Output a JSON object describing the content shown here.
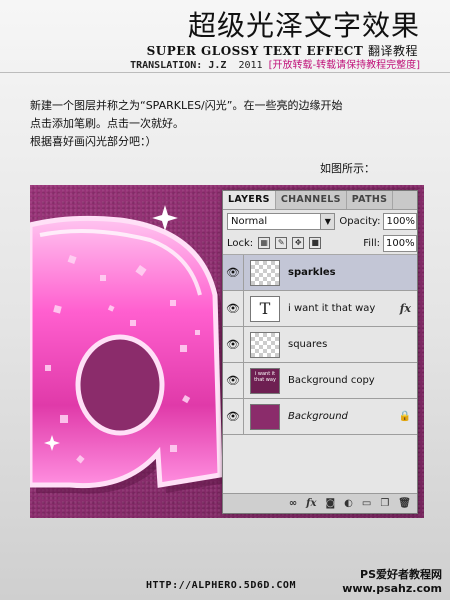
{
  "header": {
    "title_zh": "超级光泽文字效果",
    "title_en": "SUPER GLOSSY TEXT EFFECT",
    "title_en_suffix": "翻译教程",
    "translator": "TRANSLATION: J.Z",
    "year": "2011",
    "notice": "[开放转载-转载请保持教程完整度]"
  },
  "instructions": {
    "line1": "新建一个图层并称之为“SPARKLES/闪光”。在一些亮的边缘开始",
    "line2": "点击添加笔刷。点击一次就好。",
    "line3": "根据喜好画闪光部分吧：）",
    "caption": "如图所示："
  },
  "layers_panel": {
    "tabs": [
      {
        "label": "LAYERS",
        "active": true
      },
      {
        "label": "CHANNELS",
        "active": false
      },
      {
        "label": "PATHS",
        "active": false
      }
    ],
    "blend_mode": "Normal",
    "opacity_label": "Opacity:",
    "opacity_value": "100%",
    "lock_label": "Lock:",
    "fill_label": "Fill:",
    "fill_value": "100%",
    "layers": [
      {
        "name": "sparkles",
        "thumb": "transparent",
        "selected": true
      },
      {
        "name": "i want it that way",
        "thumb": "text",
        "fx": "fx"
      },
      {
        "name": "squares",
        "thumb": "transparent"
      },
      {
        "name": "Background copy",
        "thumb": "image"
      },
      {
        "name": "Background",
        "thumb": "fill",
        "italic": true,
        "locked": true
      }
    ],
    "text_thumb_glyph": "T",
    "bgcopy_thumb_text": "i want it that way"
  },
  "footer": {
    "url": "HTTP://ALPHERO.5D6D.COM",
    "watermark_line1": "PS爱好者教程网",
    "watermark_line2": "www.psahz.com"
  },
  "colors": {
    "accent": "#c0127a",
    "background_texture": "#8b2c6b",
    "glossy_pink": "#ff6ad0",
    "selected_layer": "#c3c6d6"
  }
}
